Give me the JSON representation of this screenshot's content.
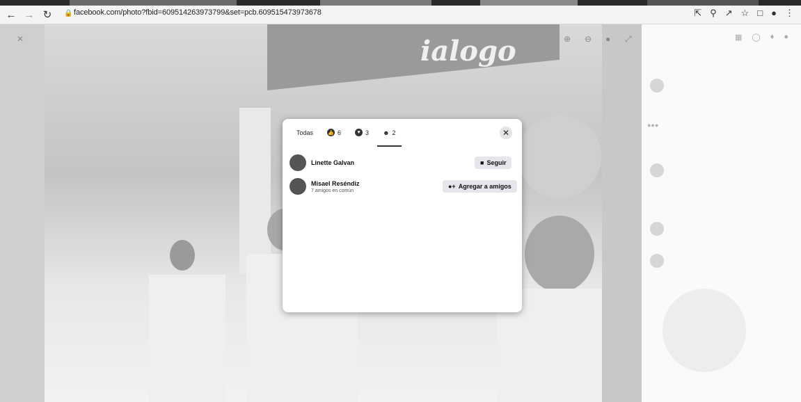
{
  "browser": {
    "url": "facebook.com/photo?fbid=609514263973799&set=pcb.609515473973678",
    "icons": [
      "back-icon",
      "forward-icon",
      "reload-icon",
      "lock-icon",
      "open-in-app-icon",
      "zoom-icon",
      "share-icon",
      "bookmark-star-icon",
      "tab-icon",
      "profile-icon",
      "menu-icon"
    ]
  },
  "photo": {
    "banner_text": "ialogo"
  },
  "modal": {
    "tabs": [
      {
        "label": "Todas",
        "count": "",
        "icon": ""
      },
      {
        "label": "",
        "count": "6",
        "icon": "like-icon"
      },
      {
        "label": "",
        "count": "3",
        "icon": "love-icon"
      },
      {
        "label": "",
        "count": "2",
        "icon": "care-icon"
      }
    ],
    "people": [
      {
        "name": "Linette Galvan",
        "subtitle": "",
        "action": "Seguir",
        "action_icon": "follow-icon"
      },
      {
        "name": "Misael Reséndiz",
        "subtitle": "7 amigos en común",
        "action": "Agregar a amigos",
        "action_icon": "add-friend-icon"
      }
    ]
  }
}
